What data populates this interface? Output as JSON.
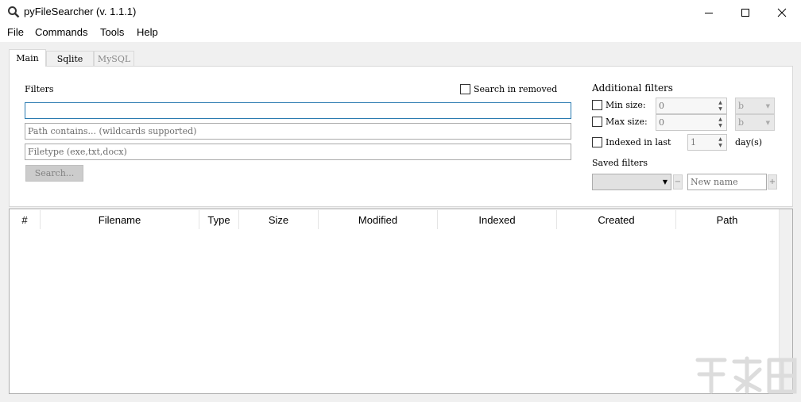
{
  "window": {
    "title": "pyFileSearcher (v. 1.1.1)",
    "app_icon": "search-icon",
    "controls": [
      "minimize-icon",
      "maximize-icon",
      "close-icon"
    ]
  },
  "menu": [
    "File",
    "Commands",
    "Tools",
    "Help"
  ],
  "tabs": [
    {
      "label": "Main",
      "active": true
    },
    {
      "label": "Sqlite",
      "active": false
    },
    {
      "label": "MySQL",
      "active": false,
      "disabled": true
    }
  ],
  "filters": {
    "heading": "Filters",
    "search_in_removed": {
      "label": "Search in removed",
      "checked": false
    },
    "name_input": {
      "value": "",
      "placeholder": ""
    },
    "path_input": {
      "value": "",
      "placeholder": "Path contains... (wildcards supported)"
    },
    "filetype_input": {
      "value": "",
      "placeholder": "Filetype (exe,txt,docx)"
    },
    "search_button": "Search..."
  },
  "additional_filters": {
    "heading": "Additional filters",
    "min_size": {
      "label": "Min size:",
      "value": "0",
      "unit": "b",
      "checked": false
    },
    "max_size": {
      "label": "Max size:",
      "value": "0",
      "unit": "b",
      "checked": false
    },
    "indexed_last": {
      "label": "Indexed in last",
      "value": "1",
      "unit": "day(s)",
      "checked": false
    }
  },
  "saved_filters": {
    "heading": "Saved filters",
    "selected": "",
    "remove_label": "−",
    "new_name_placeholder": "New name",
    "add_label": "+"
  },
  "table": {
    "columns": [
      "#",
      "Filename",
      "Type",
      "Size",
      "Modified",
      "Indexed",
      "Created",
      "Path"
    ],
    "rows": []
  }
}
